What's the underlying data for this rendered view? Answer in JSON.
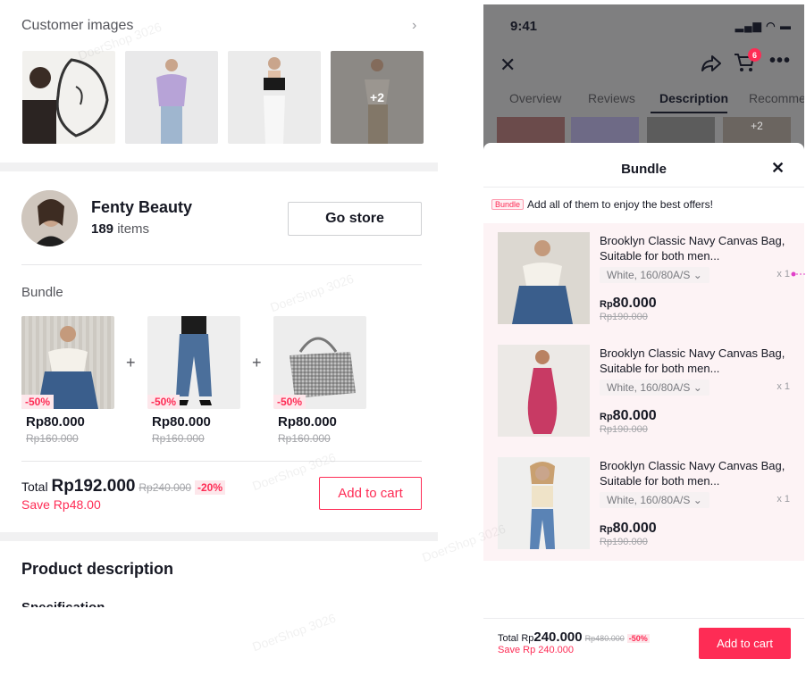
{
  "left": {
    "customer_images": {
      "title": "Customer images",
      "more_count": "+2"
    },
    "store": {
      "name": "Fenty Beauty",
      "items_count": "189",
      "items_suffix": "items",
      "go_store": "Go store"
    },
    "bundle": {
      "title": "Bundle",
      "products": [
        {
          "discount": "-50%",
          "price": "Rp80.000",
          "old_price": "Rp160.000"
        },
        {
          "discount": "-50%",
          "price": "Rp80.000",
          "old_price": "Rp160.000"
        },
        {
          "discount": "-50%",
          "price": "Rp80.000",
          "old_price": "Rp160.000"
        }
      ],
      "plus": "+",
      "total_label": "Total",
      "total_price": "Rp192.000",
      "total_old": "Rp240.000",
      "total_pct": "-20%",
      "save": "Save Rp48.00",
      "add_to_cart": "Add to cart"
    },
    "product_description": {
      "title": "Product description",
      "spec": "Specification"
    }
  },
  "phone": {
    "time": "9:41",
    "status": "▂▄▆ ◠ ▬",
    "cart_badge": "6",
    "close": "✕",
    "more": "•••",
    "tabs": [
      "Overview",
      "Reviews",
      "Description",
      "Recomme"
    ],
    "strip_more": "+2",
    "sheet": {
      "title": "Bundle",
      "close": "✕",
      "promo_tag": "Bundle",
      "promo_text": "Add all of them to enjoy the best offers!",
      "items": [
        {
          "title": "Brooklyn Classic Navy Canvas Bag, Suitable for both men...",
          "variant": "White, 160/80A/S ⌄",
          "qty": "x 1",
          "currency": "Rp",
          "price": "80.000",
          "old_price": "Rp190.000"
        },
        {
          "title": "Brooklyn Classic Navy Canvas Bag, Suitable for both men...",
          "variant": "White, 160/80A/S ⌄",
          "qty": "x 1",
          "currency": "Rp",
          "price": "80.000",
          "old_price": "Rp190.000"
        },
        {
          "title": "Brooklyn Classic Navy Canvas Bag, Suitable for both men...",
          "variant": "White, 160/80A/S ⌄",
          "qty": "x 1",
          "currency": "Rp",
          "price": "80.000",
          "old_price": "Rp190.000"
        }
      ],
      "footer": {
        "total_label": "Total",
        "currency": "Rp",
        "total": "240.000",
        "old": "Rp480.000",
        "pct": "-50%",
        "save": "Save Rp 240.000",
        "add_to_cart": "Add to cart"
      }
    }
  },
  "watermark": "DoerShop 3026",
  "colors": {
    "accent": "#fe2c55",
    "text": "#161823",
    "muted": "#55565c"
  }
}
